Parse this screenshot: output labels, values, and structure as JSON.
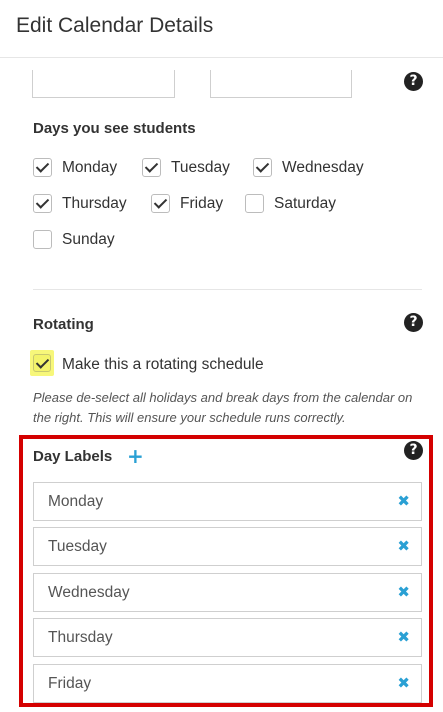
{
  "header": {
    "title": "Edit Calendar Details"
  },
  "help_icon": "?",
  "days": {
    "title": "Days you see students",
    "items": [
      {
        "label": "Monday",
        "checked": true
      },
      {
        "label": "Tuesday",
        "checked": true
      },
      {
        "label": "Wednesday",
        "checked": true
      },
      {
        "label": "Thursday",
        "checked": true
      },
      {
        "label": "Friday",
        "checked": true
      },
      {
        "label": "Saturday",
        "checked": false
      },
      {
        "label": "Sunday",
        "checked": false
      }
    ]
  },
  "rotating": {
    "title": "Rotating",
    "checkbox_label": "Make this a rotating schedule",
    "checked": true,
    "note": "Please de-select all holidays and break days from the calendar on the right. This will ensure your schedule runs correctly."
  },
  "day_labels": {
    "title": "Day Labels",
    "add_icon": "+",
    "remove_icon": "✖",
    "items": [
      "Monday",
      "Tuesday",
      "Wednesday",
      "Thursday",
      "Friday"
    ]
  }
}
